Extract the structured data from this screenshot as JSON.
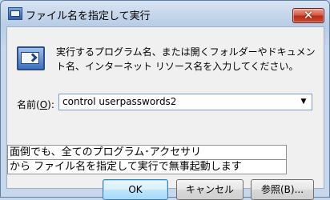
{
  "window": {
    "title": "ファイル名を指定して実行",
    "close_glyph": "✕"
  },
  "dialog": {
    "description": "実行するプログラム名、または開くフォルダーやドキュメント名、インターネット リソース名を入力してください。",
    "name_label_prefix": "名前(",
    "name_label_accel": "O",
    "name_label_suffix": "):",
    "combo_value": "control userpasswords2",
    "combo_arrow": "▼"
  },
  "tooltip": {
    "lines": [
      "面倒でも、全てのプログラム･アクセサリ",
      "から ファイル名を指定して実行で無事起動します"
    ]
  },
  "buttons": {
    "ok": "OK",
    "cancel": "キャンセル",
    "browse": "参照(B)..."
  },
  "icons": {
    "title_icon": "run-app-icon",
    "dialog_icon": "run-program-icon"
  },
  "colors": {
    "title_gradient_top": "#d8e4f3",
    "close_red": "#c84a33",
    "default_button_border": "#3c7fb1"
  }
}
